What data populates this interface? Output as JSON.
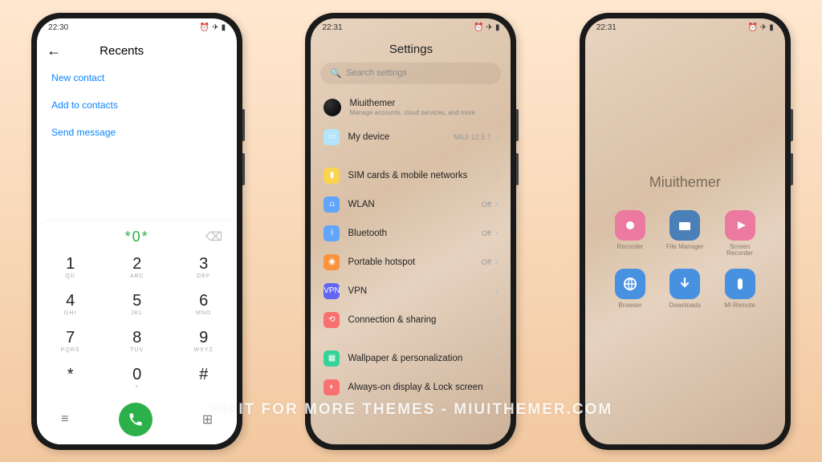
{
  "watermark": "Visit for more themes - miuithemer.com",
  "phones": {
    "dialer": {
      "time": "22:30",
      "header_title": "Recents",
      "menu": [
        "New contact",
        "Add to contacts",
        "Send message"
      ],
      "typed": "*0*",
      "keys": [
        {
          "d": "1",
          "l": "QD"
        },
        {
          "d": "2",
          "l": "ABC"
        },
        {
          "d": "3",
          "l": "DEF"
        },
        {
          "d": "4",
          "l": "GHI"
        },
        {
          "d": "5",
          "l": "JKL"
        },
        {
          "d": "6",
          "l": "MNO"
        },
        {
          "d": "7",
          "l": "PQRS"
        },
        {
          "d": "8",
          "l": "TUV"
        },
        {
          "d": "9",
          "l": "WXYZ"
        },
        {
          "d": "*",
          "l": ""
        },
        {
          "d": "0",
          "l": "+"
        },
        {
          "d": "#",
          "l": ""
        }
      ]
    },
    "settings": {
      "time": "22:31",
      "title": "Settings",
      "search_placeholder": "Search settings",
      "account": {
        "name": "Miuithemer",
        "sub": "Manage accounts, cloud services, and more"
      },
      "rows": [
        {
          "icon": "device",
          "color": "#b3e5fc",
          "label": "My device",
          "value": "MIUI 12.5.7"
        },
        null,
        {
          "icon": "sim",
          "color": "#fcd34d",
          "label": "SIM cards & mobile networks",
          "value": ""
        },
        {
          "icon": "wifi",
          "color": "#60a5fa",
          "label": "WLAN",
          "value": "Off"
        },
        {
          "icon": "bt",
          "color": "#60a5fa",
          "label": "Bluetooth",
          "value": "Off"
        },
        {
          "icon": "hotspot",
          "color": "#fb923c",
          "label": "Portable hotspot",
          "value": "Off"
        },
        {
          "icon": "vpn",
          "color": "#6366f1",
          "label": "VPN",
          "value": ""
        },
        {
          "icon": "share",
          "color": "#f87171",
          "label": "Connection & sharing",
          "value": ""
        },
        null,
        {
          "icon": "wall",
          "color": "#34d399",
          "label": "Wallpaper & personalization",
          "value": ""
        },
        {
          "icon": "aod",
          "color": "#f87171",
          "label": "Always-on display & Lock screen",
          "value": ""
        }
      ]
    },
    "home": {
      "time": "22:31",
      "folder": "Miuithemer",
      "apps": [
        {
          "name": "Recorder",
          "color": "#ec7aa0",
          "glyph": "rec"
        },
        {
          "name": "File Manager",
          "color": "#4a7fb8",
          "glyph": "folder"
        },
        {
          "name": "Screen Recorder",
          "color": "#ec7aa0",
          "glyph": "play"
        },
        {
          "name": "Browser",
          "color": "#4890e0",
          "glyph": "globe"
        },
        {
          "name": "Downloads",
          "color": "#4890e0",
          "glyph": "down"
        },
        {
          "name": "Mi Remote",
          "color": "#4890e0",
          "glyph": "remote"
        }
      ]
    }
  }
}
